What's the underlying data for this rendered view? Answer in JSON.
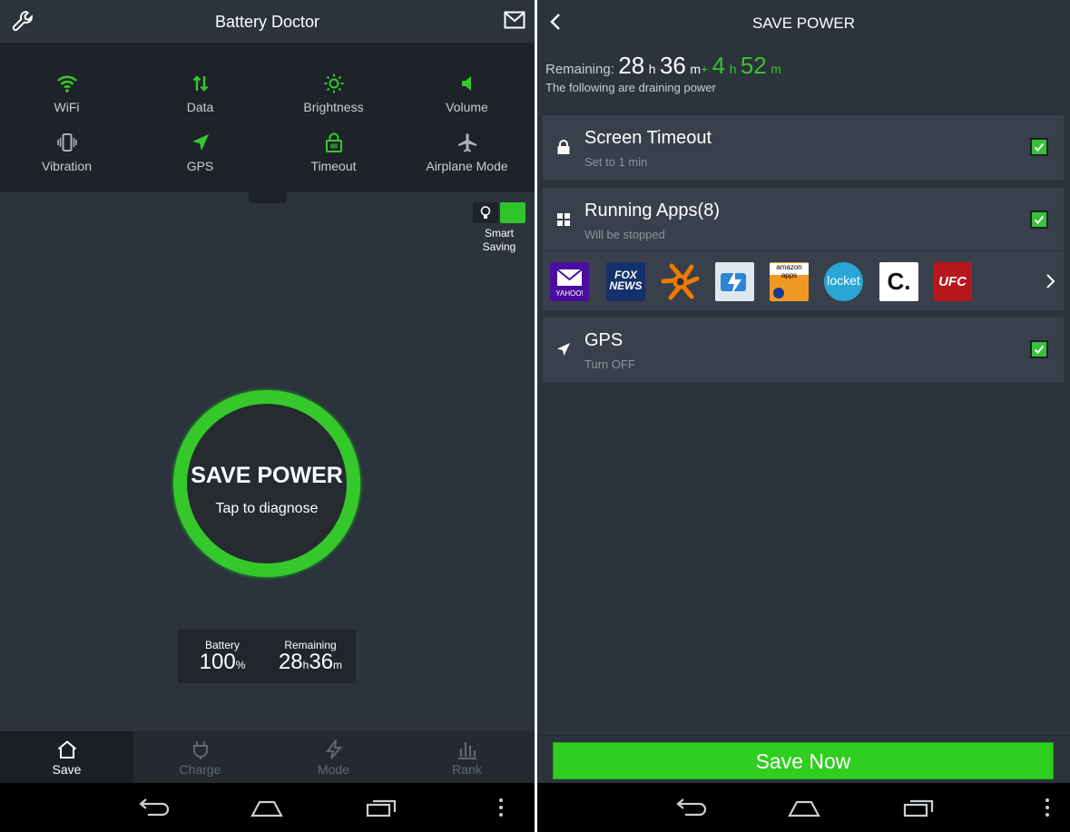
{
  "left": {
    "title": "Battery Doctor",
    "toggles": [
      {
        "label": "WiFi",
        "icon": "wifi-icon",
        "on": true
      },
      {
        "label": "Data",
        "icon": "data-arrows-icon",
        "on": true
      },
      {
        "label": "Brightness",
        "icon": "brightness-icon",
        "on": true
      },
      {
        "label": "Volume",
        "icon": "volume-icon",
        "on": true
      },
      {
        "label": "Vibration",
        "icon": "vibration-icon",
        "on": false
      },
      {
        "label": "GPS",
        "icon": "gps-arrow-icon",
        "on": true
      },
      {
        "label": "Timeout",
        "icon": "timeout-lock-icon",
        "on": true
      },
      {
        "label": "Airplane Mode",
        "icon": "airplane-icon",
        "on": false
      }
    ],
    "smart_saving": {
      "label_line1": "Smart",
      "label_line2": "Saving",
      "on": true
    },
    "circle": {
      "title": "SAVE POWER",
      "subtitle": "Tap to diagnose"
    },
    "battery": {
      "label": "Battery",
      "value": "100",
      "unit": "%"
    },
    "remaining": {
      "label": "Remaining",
      "hours": "28",
      "h": "h",
      "minutes": "36",
      "m": "m"
    },
    "tabs": [
      {
        "label": "Save",
        "icon": "home-icon",
        "active": true
      },
      {
        "label": "Charge",
        "icon": "plug-icon",
        "active": false
      },
      {
        "label": "Mode",
        "icon": "bolt-icon",
        "active": false
      },
      {
        "label": "Rank",
        "icon": "bar-chart-icon",
        "active": false
      }
    ]
  },
  "right": {
    "title": "SAVE POWER",
    "remaining_label": "Remaining:",
    "remaining_hours": "28",
    "remaining_h": "h",
    "remaining_minutes": "36",
    "remaining_m": "m",
    "gain_prefix": "+",
    "gain_hours": "4",
    "gain_h": "h",
    "gain_minutes": "52",
    "gain_m": "m",
    "draining_text": "The following are draining power",
    "items": [
      {
        "title": "Screen Timeout",
        "subtitle": "Set to 1 min",
        "checked": true,
        "icon": "lock-icon"
      },
      {
        "title": "Running Apps(8)",
        "subtitle": "Will be stopped",
        "checked": true,
        "icon": "apps-grid-icon"
      },
      {
        "title": "GPS",
        "subtitle": "Turn OFF",
        "checked": true,
        "icon": "gps-arrow-icon"
      }
    ],
    "apps": [
      {
        "name": "yahoo-mail-app-icon",
        "text": "YAHOO!"
      },
      {
        "name": "fox-news-app-icon",
        "text": "FOX NEWS"
      },
      {
        "name": "avast-app-icon",
        "text": ""
      },
      {
        "name": "battery-app-icon",
        "text": ""
      },
      {
        "name": "amazon-apps-app-icon",
        "text": "amazon apps"
      },
      {
        "name": "locket-app-icon",
        "text": "locket"
      },
      {
        "name": "c-app-icon",
        "text": "C."
      },
      {
        "name": "ufc-app-icon",
        "text": "UFC"
      }
    ],
    "save_button": "Save Now"
  },
  "colors": {
    "accent_green": "#35c82b",
    "background": "#2b333c",
    "card": "#38414b"
  }
}
